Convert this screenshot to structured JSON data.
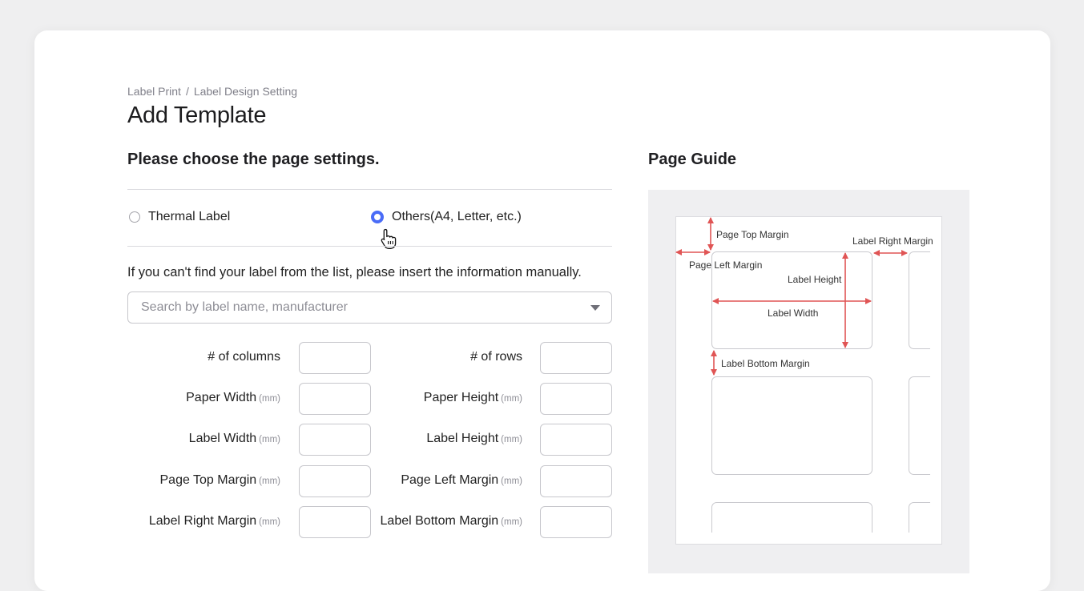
{
  "breadcrumb": {
    "items": [
      "Label Print",
      "Label Design Setting"
    ],
    "separator": "/"
  },
  "page_title": "Add Template",
  "section_title": "Please choose the page settings.",
  "page_type": {
    "options": [
      {
        "label": "Thermal Label",
        "selected": false
      },
      {
        "label": "Others(A4, Letter, etc.)",
        "selected": true
      }
    ]
  },
  "hint": "If you can't find your label from the list, please insert the information manually.",
  "search": {
    "placeholder": "Search by label name, manufacturer",
    "value": ""
  },
  "fields": {
    "columns": {
      "label": "# of columns",
      "unit": "",
      "value": ""
    },
    "rows": {
      "label": "# of rows",
      "unit": "",
      "value": ""
    },
    "paper_width": {
      "label": "Paper Width",
      "unit": "(mm)",
      "value": ""
    },
    "paper_height": {
      "label": "Paper Height",
      "unit": "(mm)",
      "value": ""
    },
    "label_width": {
      "label": "Label Width",
      "unit": "(mm)",
      "value": ""
    },
    "label_height": {
      "label": "Label Height",
      "unit": "(mm)",
      "value": ""
    },
    "page_top_margin": {
      "label": "Page Top Margin",
      "unit": "(mm)",
      "value": ""
    },
    "page_left_margin": {
      "label": "Page Left Margin",
      "unit": "(mm)",
      "value": ""
    },
    "label_right_margin": {
      "label": "Label Right Margin",
      "unit": "(mm)",
      "value": ""
    },
    "label_bottom_margin": {
      "label": "Label Bottom Margin",
      "unit": "(mm)",
      "value": ""
    }
  },
  "guide": {
    "title": "Page Guide",
    "labels": {
      "page_top_margin": "Page Top Margin",
      "label_right_margin": "Label Right Margin",
      "page_left_margin": "Page Left Margin",
      "label_height": "Label Height",
      "label_width": "Label Width",
      "label_bottom_margin": "Label Bottom Margin"
    }
  },
  "colors": {
    "accent": "#4a6cf7",
    "arrow": "#e05555",
    "background": "#efeff0"
  },
  "cursor": {
    "icon": "hand-pointer-icon"
  }
}
